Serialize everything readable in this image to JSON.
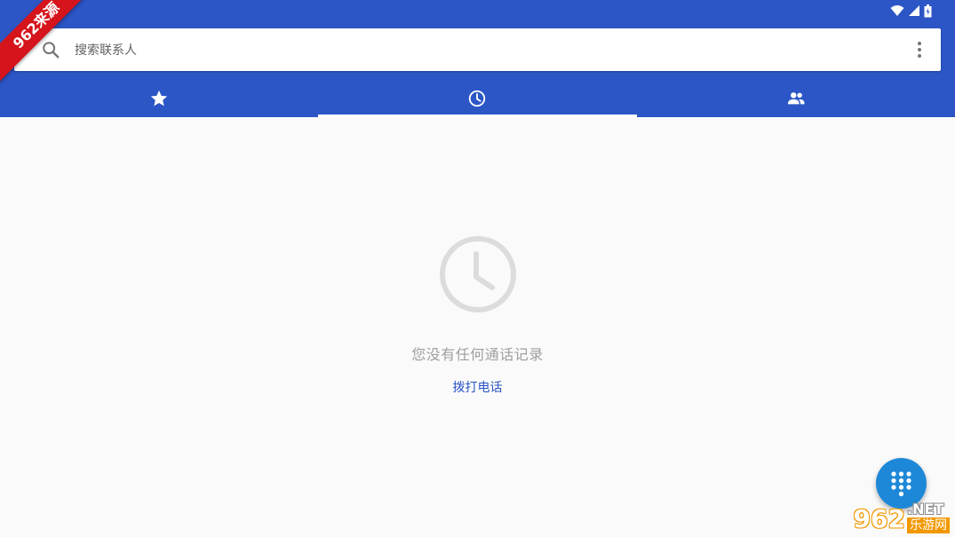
{
  "status_bar": {
    "icons": [
      "wifi-icon",
      "signal-icon",
      "battery-icon"
    ]
  },
  "search": {
    "placeholder": "搜索联系人"
  },
  "tabs": [
    {
      "icon": "star-icon",
      "name": "favorites",
      "active": false
    },
    {
      "icon": "clock-icon",
      "name": "recents",
      "active": true
    },
    {
      "icon": "people-icon",
      "name": "contacts",
      "active": false
    }
  ],
  "empty_state": {
    "icon": "clock-icon",
    "message": "您没有任何通话记录",
    "action_label": "拨打电话"
  },
  "fab": {
    "icon": "dialpad-icon"
  },
  "overlays": {
    "ribbon_text": "962来源",
    "watermark_big": "962",
    "watermark_net": ".NET",
    "watermark_cn": "乐游网"
  },
  "colors": {
    "primary": "#2c56c6",
    "fab": "#1e88d8",
    "background": "#fafafa",
    "empty_text": "#9e9e9e"
  }
}
